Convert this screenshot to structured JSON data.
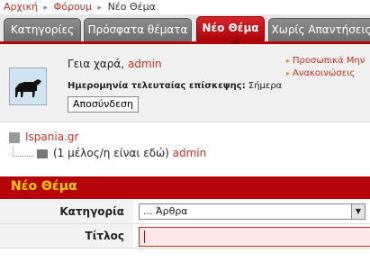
{
  "breadcrumb": {
    "home": "Αρχική",
    "forum": "Φόρουμ",
    "current": "Νέο Θέμα",
    "sep": "▸"
  },
  "tabs": [
    "Κατηγορίες",
    "Πρόσφατα θέματα",
    "Νέο Θέμα",
    "Χωρίς Απαντήσεις"
  ],
  "user": {
    "greeting": "Γεια χαρά,",
    "name": "admin",
    "last_visit_label": "Ημερομηνία τελευταίας επίσκεψης:",
    "last_visit_value": "Σήμερα",
    "logout": "Αποσύνδεση",
    "links": [
      "Προσωπικά Μην",
      "Ανακοινώσεις"
    ]
  },
  "online": {
    "site": "Ispania.gr",
    "members_text": "(1 μέλος/η είναι εδώ)",
    "member": "admin"
  },
  "form": {
    "title": "Νέο Θέμα",
    "category_label": "Κατηγορία",
    "category_value": "... Άρθρα",
    "title_label": "Τίτλος",
    "title_value": ""
  },
  "colors": {
    "accent": "#b5050a",
    "link": "#c8321e",
    "heading": "#ffcc00"
  }
}
